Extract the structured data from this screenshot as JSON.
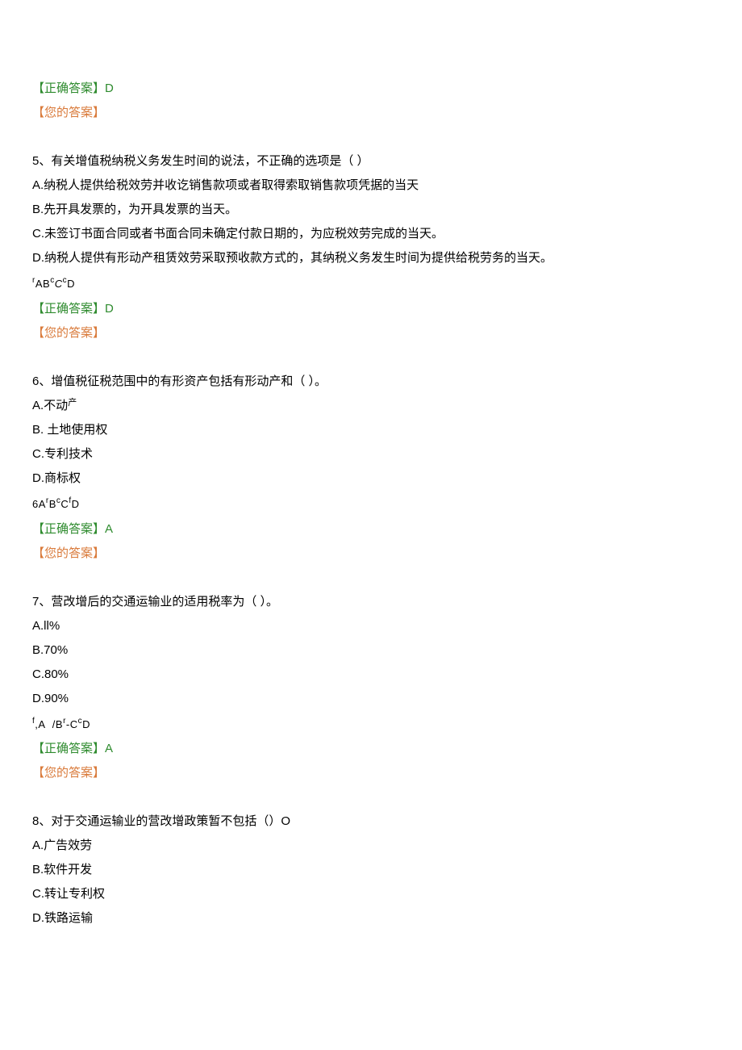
{
  "q4": {
    "correct_label": "【正确答案】",
    "correct_value": "D",
    "your_label": "【您的答案】"
  },
  "q5": {
    "question": "5、有关增值税纳税义务发生时间的说法，不正确的选项是（           ）",
    "options": {
      "A": "A.纳税人提供给税效劳并收讫销售款项或者取得索取销售款项凭据的当天",
      "B": "B.先开具发票的，为开具发票的当天。",
      "C": "C.未签订书面合同或者书面合同未确定付款日期的，为应税效劳完成的当天。",
      "D": "D.纳税人提供有形动产租赁效劳采取预收款方式的，其纳税义务发生时间为提供给税劳务的当天。"
    },
    "helper": "rABcCcD",
    "correct_label": "【正确答案】",
    "correct_value": "D",
    "your_label": "【您的答案】"
  },
  "q6": {
    "question": "6、增值税征税范围中的有形资产包括有形动产和（           ）。",
    "options": {
      "A": "A.不动产",
      "B": "B.   土地使用权",
      "C": "C.专利技术",
      "D": "D.商标权"
    },
    "helper": "6ArBcCfD",
    "correct_label": "【正确答案】",
    "correct_value": "A",
    "your_label": "【您的答案】"
  },
  "q7": {
    "question": "7、营改增后的交通运输业的适用税率为（           ）。",
    "options": {
      "A": "A.ll%",
      "B": "B.70%",
      "C": "C.80%",
      "D": "D.90%"
    },
    "helper": "f,A  /Br-CcD",
    "correct_label": "【正确答案】",
    "correct_value": "A",
    "your_label": "【您的答案】"
  },
  "q8": {
    "question": "8、对于交通运输业的营改增政策暂不包括（）O",
    "options": {
      "A": "A.广告效劳",
      "B": "B.软件开发",
      "C": "C.转让专利权",
      "D": "D.铁路运输"
    }
  }
}
